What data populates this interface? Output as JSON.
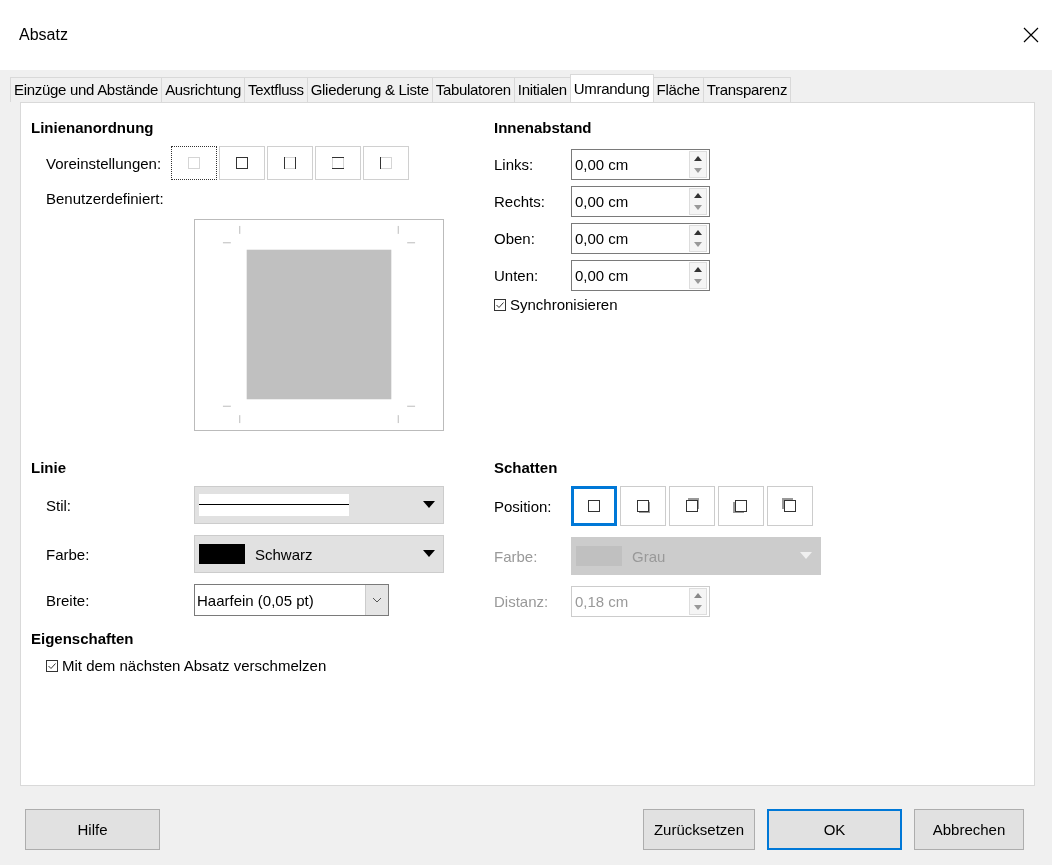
{
  "window": {
    "title": "Absatz"
  },
  "tabs": [
    {
      "label": "Einzüge und Abstände",
      "selected": false
    },
    {
      "label": "Ausrichtung",
      "selected": false
    },
    {
      "label": "Textfluss",
      "selected": false
    },
    {
      "label": "Gliederung & Liste",
      "selected": false
    },
    {
      "label": "Tabulatoren",
      "selected": false
    },
    {
      "label": "Initialen",
      "selected": false
    },
    {
      "label": "Umrandung",
      "selected": true
    },
    {
      "label": "Fläche",
      "selected": false
    },
    {
      "label": "Transparenz",
      "selected": false
    }
  ],
  "line_arrangement": {
    "heading": "Linienanordnung",
    "presets_label": "Voreinstellungen:",
    "presets": [
      {
        "kind": "none",
        "selected": true
      },
      {
        "kind": "all",
        "selected": false
      },
      {
        "kind": "left-right",
        "selected": false
      },
      {
        "kind": "top-bottom",
        "selected": false
      },
      {
        "kind": "left",
        "selected": false
      }
    ],
    "custom_label": "Benutzerdefiniert:"
  },
  "padding": {
    "heading": "Innenabstand",
    "fields": [
      {
        "label": "Links:",
        "value": "0,00 cm"
      },
      {
        "label": "Rechts:",
        "value": "0,00 cm"
      },
      {
        "label": "Oben:",
        "value": "0,00 cm"
      },
      {
        "label": "Unten:",
        "value": "0,00 cm"
      }
    ],
    "sync": {
      "label": "Synchronisieren",
      "checked": true
    }
  },
  "line": {
    "heading": "Linie",
    "style_label": "Stil:",
    "color_label": "Farbe:",
    "color_value": "Schwarz",
    "width_label": "Breite:",
    "width_value": "Haarfein (0,05 pt)"
  },
  "shadow": {
    "heading": "Schatten",
    "position_label": "Position:",
    "positions": [
      {
        "kind": "none",
        "selected": true
      },
      {
        "kind": "bottom-right",
        "selected": false
      },
      {
        "kind": "top-right",
        "selected": false
      },
      {
        "kind": "bottom-left",
        "selected": false
      },
      {
        "kind": "top-left",
        "selected": false
      }
    ],
    "color_label": "Farbe:",
    "color_value": "Grau",
    "color_disabled": true,
    "distance_label": "Distanz:",
    "distance_value": "0,18 cm",
    "distance_disabled": true
  },
  "properties": {
    "heading": "Eigenschaften",
    "merge": {
      "label": "Mit dem nächsten Absatz verschmelzen",
      "checked": true
    }
  },
  "buttons": [
    {
      "label": "Hilfe",
      "kind": "help"
    },
    {
      "label": "Zurücksetzen",
      "kind": "normal"
    },
    {
      "label": "OK",
      "kind": "default"
    },
    {
      "label": "Abbrechen",
      "kind": "normal"
    }
  ]
}
